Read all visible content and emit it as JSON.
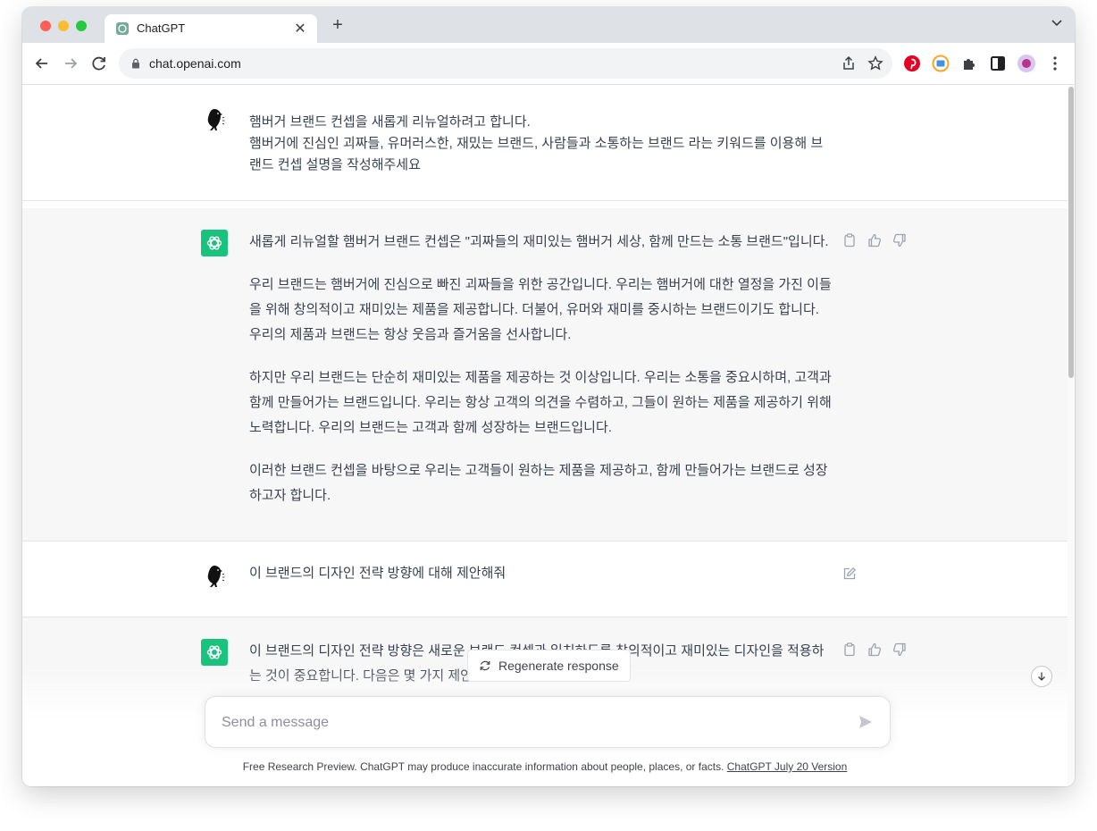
{
  "browser": {
    "tab_title": "ChatGPT",
    "url": "chat.openai.com"
  },
  "conversation": [
    {
      "role": "user",
      "lines": [
        "햄버거 브랜드 컨셉을 새롭게 리뉴얼하려고 합니다.",
        "햄버거에 진심인 괴짜들, 유머러스한, 재밌는 브랜드, 사람들과 소통하는 브랜드 라는 키워드를 이용해 브랜드 컨셉 설명을 작성해주세요"
      ]
    },
    {
      "role": "assistant",
      "paragraphs": [
        "새롭게 리뉴얼할 햄버거 브랜드 컨셉은 \"괴짜들의 재미있는 햄버거 세상, 함께 만드는 소통 브랜드\"입니다.",
        "우리 브랜드는 햄버거에 진심으로 빠진 괴짜들을 위한 공간입니다. 우리는 햄버거에 대한 열정을 가진 이들을 위해 창의적이고 재미있는 제품을 제공합니다. 더불어, 유머와 재미를 중시하는 브랜드이기도 합니다. 우리의 제품과 브랜드는 항상 웃음과 즐거움을 선사합니다.",
        "하지만 우리 브랜드는 단순히 재미있는 제품을 제공하는 것 이상입니다. 우리는 소통을 중요시하며, 고객과 함께 만들어가는 브랜드입니다. 우리는 항상 고객의 의견을 수렴하고, 그들이 원하는 제품을 제공하기 위해 노력합니다. 우리의 브랜드는 고객과 함께 성장하는 브랜드입니다.",
        "이러한 브랜드 컨셉을 바탕으로 우리는 고객들이 원하는 제품을 제공하고, 함께 만들어가는 브랜드로 성장하고자 합니다."
      ]
    },
    {
      "role": "user",
      "lines": [
        "이 브랜드의 디자인 전략 방향에 대해 제안해줘"
      ]
    },
    {
      "role": "assistant",
      "paragraphs": [
        "이 브랜드의 디자인 전략 방향은 새로운 브랜드 컨셉과 일치하도록 창의적이고 재미있는 디자인을 적용하는 것이 중요합니다. 다음은 몇 가지 제안입니다."
      ]
    }
  ],
  "regenerate_label": "Regenerate response",
  "composer": {
    "placeholder": "Send a message"
  },
  "footer": {
    "text": "Free Research Preview. ChatGPT may produce inaccurate information about people, places, or facts. ",
    "link": "ChatGPT July 20 Version"
  }
}
